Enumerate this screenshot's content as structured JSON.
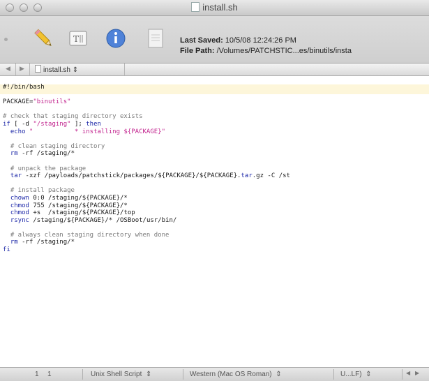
{
  "window": {
    "title": "install.sh"
  },
  "toolbar": {
    "last_saved_label": "Last Saved:",
    "last_saved_value": "10/5/08 12:24:26 PM",
    "file_path_label": "File Path:",
    "file_path_value": "/Volumes/PATCHSTIC...es/binutils/insta"
  },
  "navbar": {
    "back": "◀",
    "forward": "▶",
    "file_name": "install.sh",
    "popup_arrow": "⇕"
  },
  "editor": {
    "lines": [
      "#!/bin/bash",
      "",
      "PACKAGE=\"binutils\"",
      "",
      "# check that staging directory exists",
      "if [ -d \"/staging\" ]; then",
      "  echo \"           * installing ${PACKAGE}\"",
      "",
      "  # clean staging directory",
      "  rm -rf /staging/*",
      "",
      "  # unpack the package",
      "  tar -xzf /payloads/patchstick/packages/${PACKAGE}/${PACKAGE}.tar.gz -C /st",
      "",
      "  # install package",
      "  chown 0:0 /staging/${PACKAGE}/*",
      "  chmod 755 /staging/${PACKAGE}/*",
      "  chmod +s  /staging/${PACKAGE}/top",
      "  rsync /staging/${PACKAGE}/* /OSBoot/usr/bin/",
      "",
      "  # always clean staging directory when done",
      "  rm -rf /staging/*",
      "fi"
    ]
  },
  "statusbar": {
    "line": "1",
    "column": "1",
    "syntax": "Unix Shell Script",
    "encoding": "Western (Mac OS Roman)",
    "line_endings": "U...LF)",
    "popup_arrow": "⇕"
  },
  "colors": {
    "keyword": "#1d28a8",
    "string": "#c2238e",
    "comment": "#7a7a7a",
    "current_line": "#fdf6da"
  }
}
